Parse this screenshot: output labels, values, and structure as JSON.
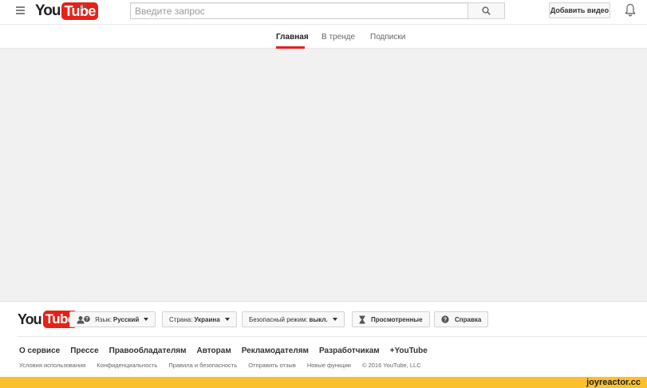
{
  "masthead": {
    "logo": {
      "you": "You",
      "tube": "Tube"
    },
    "region": "UA",
    "search": {
      "placeholder": "Введите запрос",
      "value": ""
    },
    "upload_label": "Добавить видео",
    "icons": {
      "menu": "hamburger-menu-icon",
      "search": "search-icon",
      "notifications": "bell-icon"
    }
  },
  "nav": {
    "tabs": [
      {
        "label": "Главная",
        "active": true
      },
      {
        "label": "В тренде",
        "active": false
      },
      {
        "label": "Подписки",
        "active": false
      }
    ]
  },
  "footer": {
    "logo": {
      "you": "You",
      "tube": "Tube"
    },
    "buttons": {
      "language": {
        "prefix": "Язык:",
        "value": "Русский"
      },
      "country": {
        "prefix": "Страна:",
        "value": "Украина"
      },
      "safety": {
        "prefix": "Безопасный режим:",
        "value": "выкл."
      },
      "history": {
        "label": "Просмотренные"
      },
      "help": {
        "label": "Справка"
      }
    },
    "links_primary": [
      "О сервисе",
      "Прессе",
      "Правообладателям",
      "Авторам",
      "Рекламодателям",
      "Разработчикам",
      "+YouTube"
    ],
    "links_secondary": [
      "Условия использования",
      "Конфиденциальность",
      "Правила и безопасность",
      "Отправить отзыв",
      "Новые функции"
    ],
    "copyright": "© 2016 YouTube, LLC"
  },
  "watermark": "joyreactor.cc",
  "colors": {
    "brand_red": "#e62117",
    "content_bg": "#f1f1f1",
    "watermark_bg": "#fbc02d"
  }
}
